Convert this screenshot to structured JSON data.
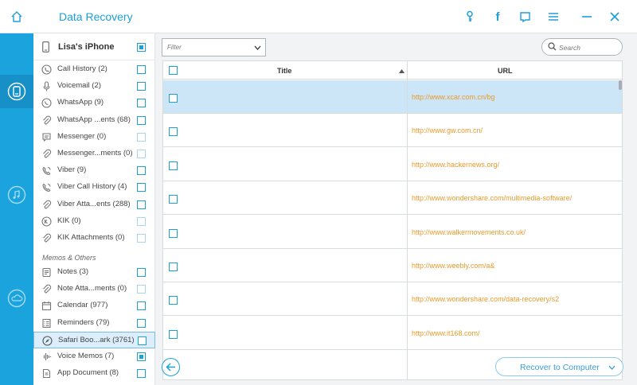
{
  "app": {
    "title": "Data Recovery"
  },
  "topbar_icons": [
    "home-icon",
    "key-icon",
    "facebook-icon",
    "feedback-icon",
    "menu-icon",
    "minimize-icon",
    "close-icon"
  ],
  "rail_icons": [
    "phone-recover-icon",
    "itunes-icon",
    "icloud-icon"
  ],
  "device": {
    "name": "Lisa's iPhone"
  },
  "categories": [
    {
      "label": "Call History (2)",
      "icon": "phone-icon",
      "checked": false,
      "dim": false
    },
    {
      "label": "Voicemail (2)",
      "icon": "mic-icon",
      "checked": false,
      "dim": false
    },
    {
      "label": "WhatsApp (9)",
      "icon": "whatsapp-icon",
      "checked": false,
      "dim": false
    },
    {
      "label": "WhatsApp ...ents (68)",
      "icon": "attachment-icon",
      "checked": false,
      "dim": false
    },
    {
      "label": "Messenger (0)",
      "icon": "messenger-icon",
      "checked": false,
      "dim": true
    },
    {
      "label": "Messenger...ments (0)",
      "icon": "attachment-icon",
      "checked": false,
      "dim": true
    },
    {
      "label": "Viber (9)",
      "icon": "viber-icon",
      "checked": false,
      "dim": false
    },
    {
      "label": "Viber Call History (4)",
      "icon": "viber-icon",
      "checked": false,
      "dim": false
    },
    {
      "label": "Viber Atta...ents (288)",
      "icon": "attachment-icon",
      "checked": false,
      "dim": false
    },
    {
      "label": "KIK (0)",
      "icon": "kik-icon",
      "checked": false,
      "dim": true
    },
    {
      "label": "KIK Attachments (0)",
      "icon": "attachment-icon",
      "checked": false,
      "dim": true
    }
  ],
  "section_label": "Memos & Others",
  "memo_categories": [
    {
      "label": "Notes (3)",
      "icon": "notes-icon",
      "checked": false,
      "dim": false,
      "selected": false
    },
    {
      "label": "Note Atta...ments (0)",
      "icon": "attachment-icon",
      "checked": false,
      "dim": true,
      "selected": false
    },
    {
      "label": "Calendar (977)",
      "icon": "calendar-icon",
      "checked": false,
      "dim": false,
      "selected": false
    },
    {
      "label": "Reminders (79)",
      "icon": "reminders-icon",
      "checked": false,
      "dim": false,
      "selected": false
    },
    {
      "label": "Safari Boo...ark (3761)",
      "icon": "safari-icon",
      "checked": false,
      "dim": false,
      "selected": true
    },
    {
      "label": "Voice Memos (7)",
      "icon": "voice-memo-icon",
      "checked": true,
      "dim": false,
      "selected": false
    },
    {
      "label": "App Document (8)",
      "icon": "document-icon",
      "checked": false,
      "dim": false,
      "selected": false
    }
  ],
  "filter": {
    "value": "Filter"
  },
  "search": {
    "placeholder": "Search"
  },
  "table": {
    "columns": [
      "Title",
      "URL"
    ],
    "rows": [
      {
        "title": "",
        "url": "http://www.xcar.com.cn/bg",
        "selected": true
      },
      {
        "title": "",
        "url": "http://www.gw.com.cn/",
        "selected": false
      },
      {
        "title": "",
        "url": "http://www.hackernews.org/",
        "selected": false
      },
      {
        "title": "",
        "url": "http://www.wondershare.com/multimedia-software/",
        "selected": false
      },
      {
        "title": "",
        "url": "http://www.walkermovements.co.uk/",
        "selected": false
      },
      {
        "title": "",
        "url": "http://www.weebly.com/a&",
        "selected": false
      },
      {
        "title": "",
        "url": "http://www.wondershare.com/data-recovery/s2",
        "selected": false
      },
      {
        "title": "",
        "url": "http://www.it168.com/",
        "selected": false
      }
    ]
  },
  "footer": {
    "recover_label": "Recover to Computer"
  },
  "colors": {
    "accent": "#1d9fd8",
    "rail": "#1ba3dd",
    "url": "#e89a2b",
    "selected_row": "#cde6f7"
  }
}
